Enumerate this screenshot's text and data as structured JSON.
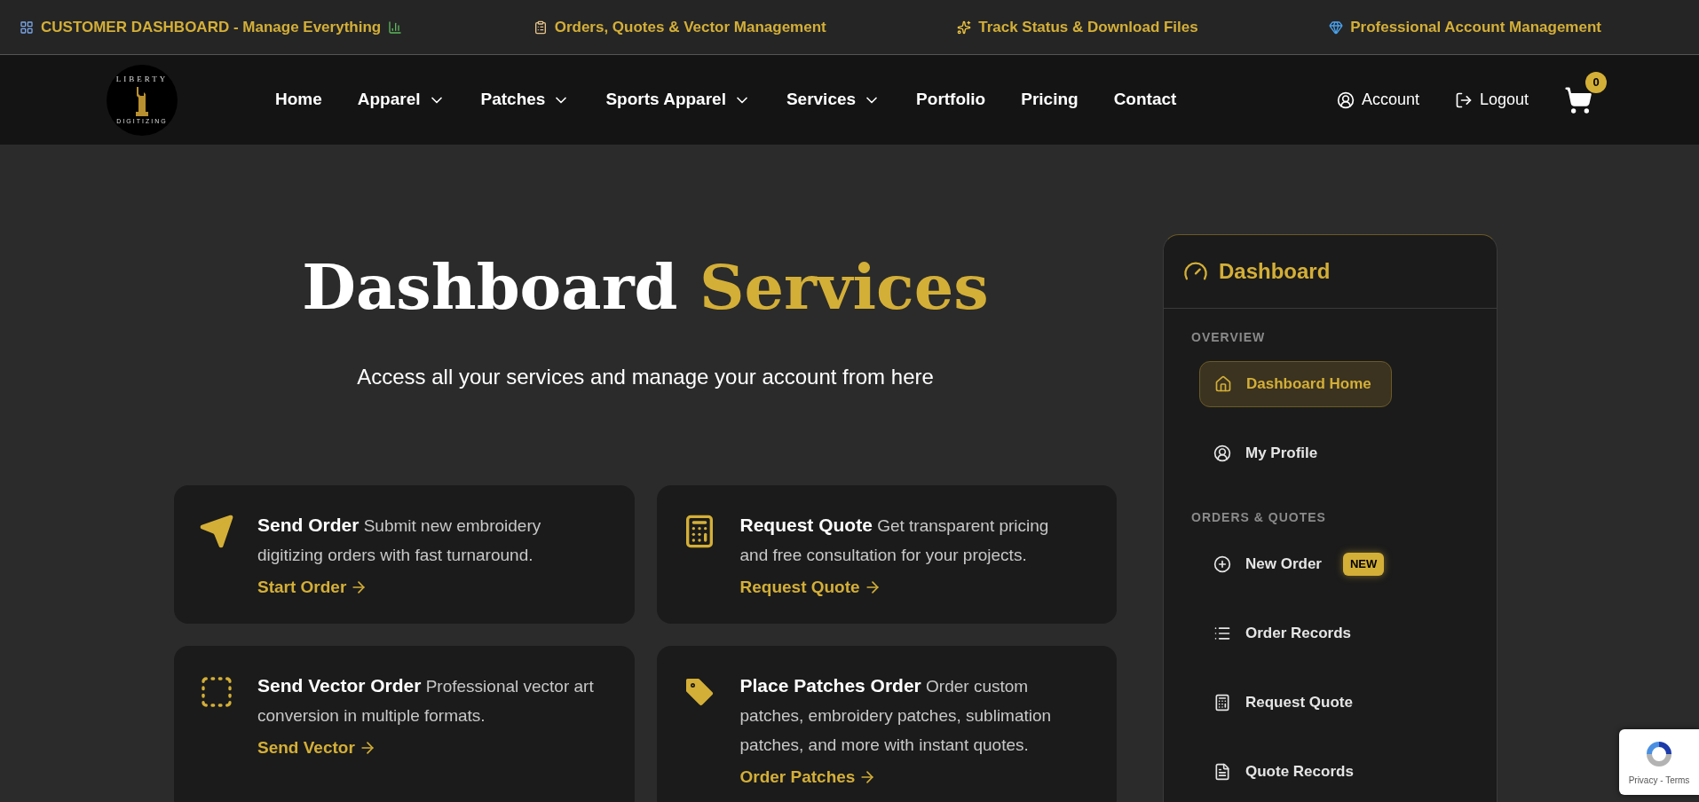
{
  "announcement_bar": [
    {
      "kind": "dashboard",
      "text": "CUSTOMER DASHBOARD - Manage Everything"
    },
    {
      "kind": "orders",
      "text": "Orders, Quotes & Vector Management"
    },
    {
      "kind": "tracking",
      "text": "Track Status & Download Files"
    },
    {
      "kind": "account",
      "text": "Professional Account Management"
    }
  ],
  "logo": {
    "top_text": "LIBERTY",
    "bottom_text": "DIGITIZING"
  },
  "nav": [
    {
      "label": "Home",
      "has_dropdown": false
    },
    {
      "label": "Apparel",
      "has_dropdown": true
    },
    {
      "label": "Patches",
      "has_dropdown": true
    },
    {
      "label": "Sports Apparel",
      "has_dropdown": true
    },
    {
      "label": "Services",
      "has_dropdown": true
    },
    {
      "label": "Portfolio",
      "has_dropdown": false
    },
    {
      "label": "Pricing",
      "has_dropdown": false
    },
    {
      "label": "Contact",
      "has_dropdown": false
    }
  ],
  "account_links": [
    {
      "kind": "account",
      "label": "Account"
    },
    {
      "kind": "logout",
      "label": "Logout"
    }
  ],
  "cart": {
    "count": "0"
  },
  "hero": {
    "title": "Dashboard",
    "title_accent": "Services",
    "subtitle": "Access all your services and manage your account from here"
  },
  "cards": [
    {
      "kind": "order",
      "title": "Send Order",
      "description": "Submit new embroidery digitizing orders with fast turnaround.",
      "link": "Start Order"
    },
    {
      "kind": "quote",
      "title": "Request Quote",
      "description": "Get transparent pricing and free consultation for your projects.",
      "link": "Request Quote"
    },
    {
      "kind": "vector",
      "title": "Send Vector Order",
      "description": "Professional vector art conversion in multiple formats.",
      "link": "Send Vector"
    },
    {
      "kind": "patches",
      "title": "Place Patches Order",
      "description": "Order custom patches, embroidery patches, sublimation patches, and more with instant quotes.",
      "link": "Order Patches"
    }
  ],
  "sidebar": {
    "title": "Dashboard",
    "sections": [
      {
        "heading": "OVERVIEW",
        "items": [
          {
            "kind": "home",
            "label": "Dashboard Home",
            "selected": true
          },
          {
            "kind": "profile",
            "label": "My Profile",
            "selected": false
          }
        ]
      },
      {
        "heading": "ORDERS & QUOTES",
        "items": [
          {
            "kind": "new_order",
            "label": "New Order",
            "selected": false,
            "badge": "NEW"
          },
          {
            "kind": "order_records",
            "label": "Order Records",
            "selected": false
          },
          {
            "kind": "quote",
            "label": "Request Quote",
            "selected": false
          },
          {
            "kind": "quote_records",
            "label": "Quote Records",
            "selected": false
          }
        ]
      }
    ]
  },
  "recaptcha": {
    "text": "Privacy - Terms"
  }
}
